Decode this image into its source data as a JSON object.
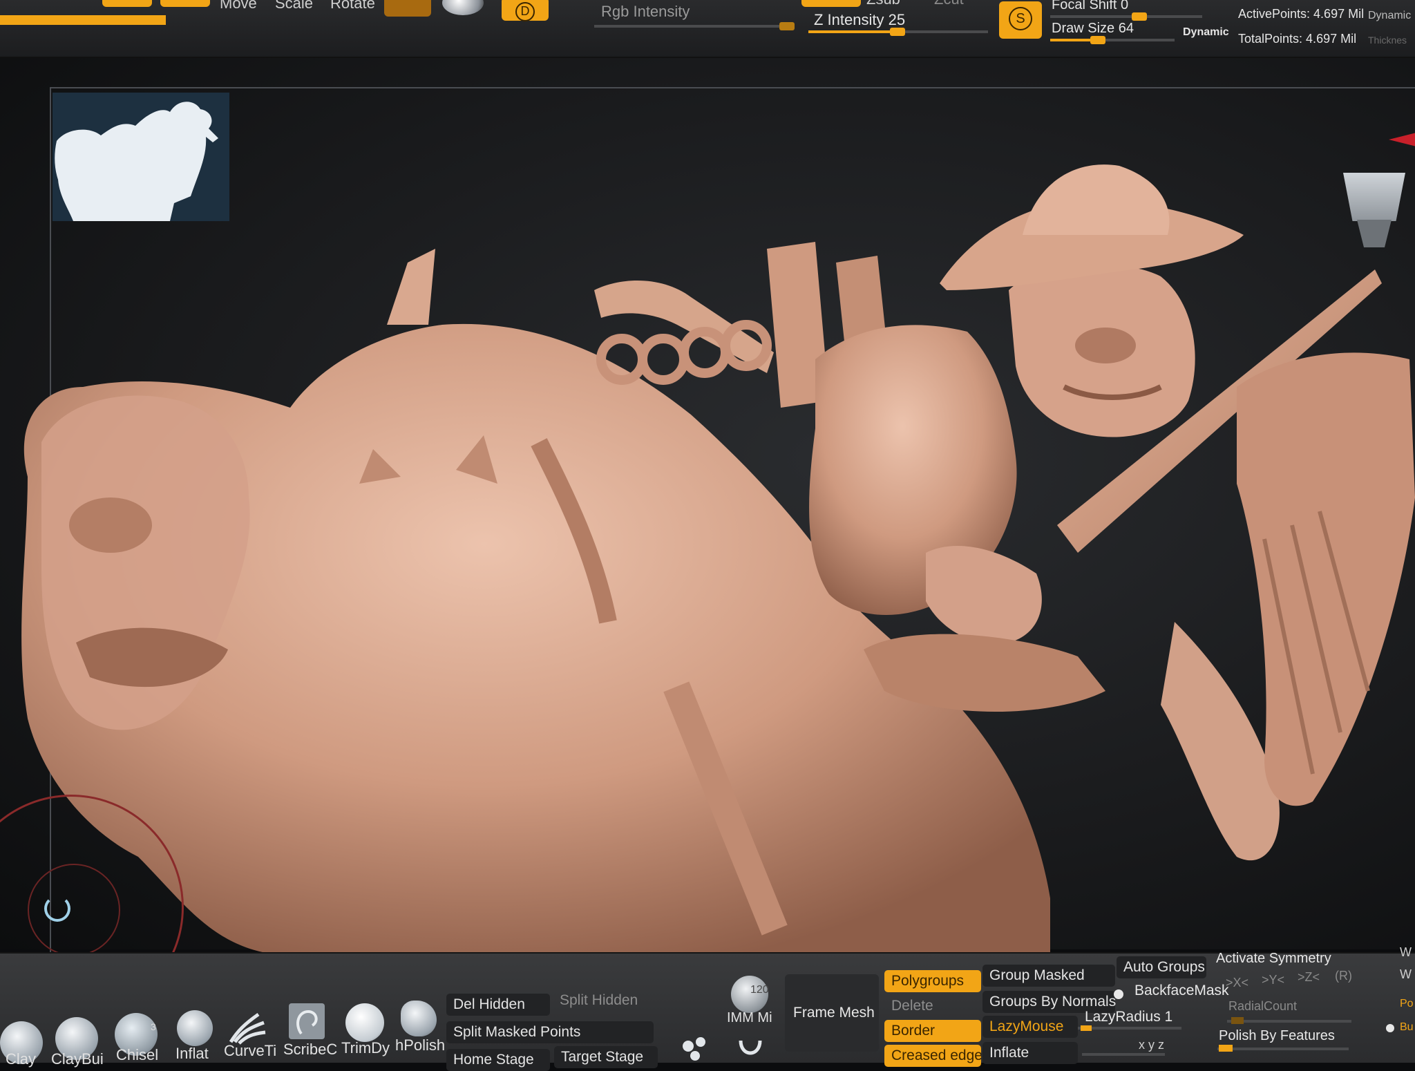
{
  "topbar": {
    "move_label": "Move",
    "scale_label": "Scale",
    "rotate_label": "Rotate",
    "d_button": "D",
    "rgb_intensity_label": "Rgb Intensity",
    "z_intensity_label": "Z Intensity 25",
    "zsub_label": "Zsub",
    "zcut_label": "Zcut",
    "s_button": "S",
    "focal_shift_label": "Focal Shift 0",
    "draw_size_label": "Draw Size 64",
    "dynamic_label": "Dynamic",
    "active_points": "ActivePoints: 4.697 Mil",
    "total_points": "TotalPoints: 4.697 Mil",
    "dynamic_right": "Dynamic",
    "thickness_label": "Thicknes",
    "accent_color": "#f2a516"
  },
  "bottom": {
    "brushes": [
      {
        "label": "Clay"
      },
      {
        "label": "ClayBui"
      },
      {
        "label": "Chisel",
        "badge": "3"
      },
      {
        "label": "Inflat"
      },
      {
        "label": "CurveTi"
      },
      {
        "label": "ScribeC"
      },
      {
        "label": "TrimDy"
      },
      {
        "label": "hPolish"
      }
    ],
    "del_hidden": "Del Hidden",
    "split_hidden": "Split Hidden",
    "split_masked_points": "Split Masked Points",
    "home_stage": "Home Stage",
    "target_stage": "Target Stage",
    "imm_label": "IMM Mi",
    "imm_badge": "120",
    "frame_mesh": "Frame Mesh",
    "polygroups": "Polygroups",
    "delete": "Delete",
    "border": "Border",
    "creased_edges": "Creased edges",
    "group_masked": "Group Masked",
    "groups_by_normals": "Groups By Normals",
    "lazymouse": "LazyMouse",
    "inflate": "Inflate",
    "auto_groups": "Auto Groups",
    "backfacemask": "BackfaceMask",
    "lazyradius": "LazyRadius 1",
    "activate_symmetry": "Activate Symmetry",
    "axis_x": ">X<",
    "axis_y": ">Y<",
    "axis_z": ">Z<",
    "axis_r": "(R)",
    "radialcount": "RadialCount",
    "polish_by_features": "Polish By Features",
    "xyz_small": "x y z",
    "right_w1": "W",
    "right_w2": "W",
    "right_p": "Po",
    "right_b": "Bu"
  },
  "viewport": {
    "model_color": "#cf9a80",
    "background_color": "#1a1b1d"
  }
}
